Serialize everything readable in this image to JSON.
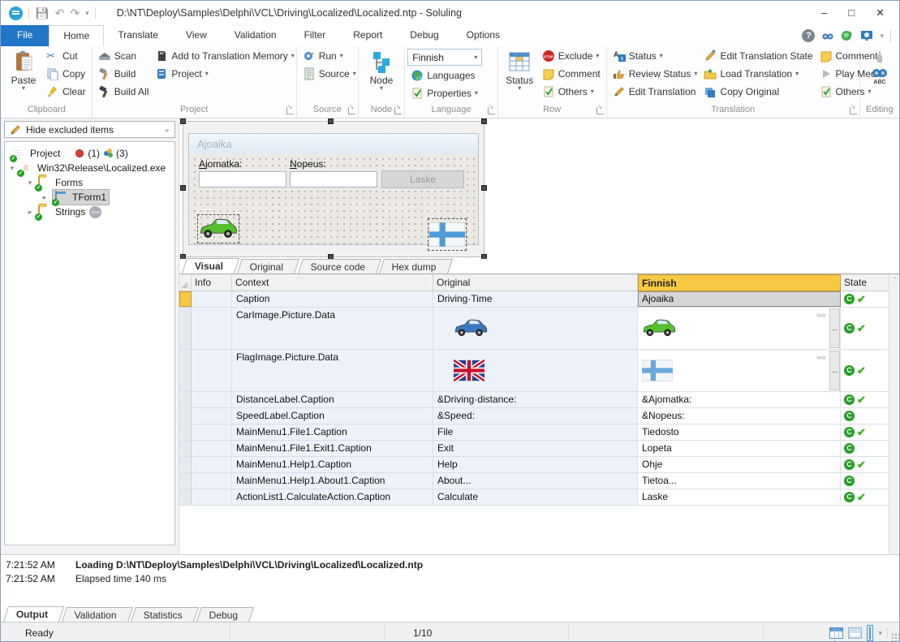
{
  "window": {
    "title": "D:\\NT\\Deploy\\Samples\\Delphi\\VCL\\Driving\\Localized\\Localized.ntp  -  Soluling"
  },
  "tabs": [
    "File",
    "Home",
    "Translate",
    "View",
    "Validation",
    "Filter",
    "Report",
    "Debug",
    "Options"
  ],
  "ribbon": {
    "clipboard": {
      "label": "Clipboard",
      "paste": "Paste",
      "cut": "Cut",
      "copy": "Copy",
      "clear": "Clear"
    },
    "project": {
      "label": "Project",
      "scan": "Scan",
      "build": "Build",
      "build_all": "Build All",
      "add_to_tm": "Add to Translation Memory",
      "project_menu": "Project"
    },
    "source": {
      "label": "Source",
      "run": "Run",
      "source_menu": "Source"
    },
    "node": {
      "label": "Node",
      "node_button": "Node"
    },
    "language": {
      "label": "Language",
      "selected_language": "Finnish",
      "languages": "Languages",
      "properties": "Properties"
    },
    "row": {
      "label": "Row",
      "status": "Status",
      "exclude": "Exclude",
      "comment": "Comment",
      "others": "Others"
    },
    "translation": {
      "label": "Translation",
      "status": "Status",
      "review_status": "Review Status",
      "edit_translation": "Edit Translation",
      "edit_translation_state": "Edit Translation State",
      "load_translation": "Load Translation",
      "copy_original": "Copy Original",
      "comment": "Comment",
      "play_media": "Play Media",
      "others": "Others"
    },
    "editing": {
      "label": "Editing",
      "abc_label": "ABC"
    }
  },
  "sidebar": {
    "filter_dropdown": "Hide excluded items",
    "tree": {
      "project": {
        "label": "Project",
        "badge_1": "(1)",
        "badge_2": "(3)"
      },
      "exe": {
        "label": "Win32\\Release\\Localized.exe"
      },
      "forms": {
        "label": "Forms"
      },
      "tform1": {
        "label": "TForm1"
      },
      "strings": {
        "label": "Strings",
        "stop_badge": "STOP"
      }
    }
  },
  "designer": {
    "form_title": "Ajoaika",
    "distance_label": "Ajomatka:",
    "speed_label": "Nopeus:",
    "calculate_button": "Laske"
  },
  "view_tabs": [
    "Visual",
    "Original",
    "Source code",
    "Hex dump"
  ],
  "grid": {
    "columns": {
      "info": "Info",
      "context": "Context",
      "original": "Original",
      "target": "Finnish",
      "state": "State"
    },
    "more_button": "...",
    "rows": [
      {
        "context": "Caption",
        "original": "Driving·Time",
        "finnish": "Ajoaika",
        "state": "C",
        "has_check": true
      },
      {
        "context": "CarImage.Picture.Data",
        "original": "",
        "finnish": "",
        "state": "C",
        "has_check": true
      },
      {
        "context": "FlagImage.Picture.Data",
        "original": "",
        "finnish": "",
        "state": "C",
        "has_check": true
      },
      {
        "context": "DistanceLabel.Caption",
        "original": "&Driving·distance:",
        "finnish": "&Ajomatka:",
        "state": "C",
        "has_check": true
      },
      {
        "context": "SpeedLabel.Caption",
        "original": "&Speed:",
        "finnish": "&Nopeus:",
        "state": "C",
        "has_check": false
      },
      {
        "context": "MainMenu1.File1.Caption",
        "original": "File",
        "finnish": "Tiedosto",
        "state": "C",
        "has_check": true
      },
      {
        "context": "MainMenu1.File1.Exit1.Caption",
        "original": "Exit",
        "finnish": "Lopeta",
        "state": "C",
        "has_check": false
      },
      {
        "context": "MainMenu1.Help1.Caption",
        "original": "Help",
        "finnish": "Ohje",
        "state": "C",
        "has_check": true
      },
      {
        "context": "MainMenu1.Help1.About1.Caption",
        "original": "About...",
        "finnish": "Tietoa...",
        "state": "C",
        "has_check": false
      },
      {
        "context": "ActionList1.CalculateAction.Caption",
        "original": "Calculate",
        "finnish": "Laske",
        "state": "C",
        "has_check": true
      }
    ]
  },
  "output": {
    "tabs": [
      "Output",
      "Validation",
      "Statistics",
      "Debug"
    ],
    "lines": [
      {
        "time": "7:21:52 AM",
        "text": "Loading D:\\NT\\Deploy\\Samples\\Delphi\\VCL\\Driving\\Localized\\Localized.ntp"
      },
      {
        "time": "7:21:52 AM",
        "text": "Elapsed time 140 ms"
      }
    ]
  },
  "status_bar": {
    "ready": "Ready",
    "row_position": "1/10"
  },
  "colors": {
    "file_tab_blue": "#2176c7",
    "target_column_yellow": "#f8c845",
    "translated_green": "#21a121",
    "row_tint_blue": "#edf2fa",
    "selected_cell_gray": "#d6d6d6"
  }
}
